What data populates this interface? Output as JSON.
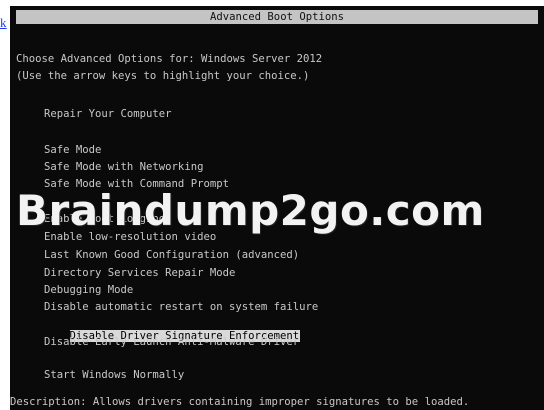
{
  "left_link": {
    "text": "k"
  },
  "console": {
    "title": "Advanced Boot Options",
    "intro_line1": "Choose Advanced Options for: Windows Server 2012",
    "intro_line2": "(Use the arrow keys to highlight your choice.)",
    "menu": {
      "repair": "Repair Your Computer",
      "safe_mode": "Safe Mode",
      "safe_mode_networking": "Safe Mode with Networking",
      "safe_mode_cmd": "Safe Mode with Command Prompt",
      "boot_logging": "Enable Boot Logging",
      "low_res_video": "Enable low-resolution video",
      "last_known_good": "Last Known Good Configuration (advanced)",
      "ds_repair": "Directory Services Repair Mode",
      "debugging": "Debugging Mode",
      "disable_auto_restart": "Disable automatic restart on system failure",
      "disable_driver_sig": "Disable Driver Signature Enforcement",
      "disable_elam": "Disable Early Launch Anti-Malware Driver",
      "start_normally": "Start Windows Normally"
    },
    "selected_item": "disable_driver_sig",
    "description_line": "Description: Allows drivers containing improper signatures to be loaded."
  },
  "watermark": {
    "text": "Braindump2go.com"
  },
  "colors": {
    "console_bg": "#0a0a0a",
    "console_text": "#c8c8c8",
    "title_bg": "#c4c4c4",
    "highlight_bg": "#d9d9d9",
    "link": "#1a3cff",
    "watermark": "#f2f2f2"
  }
}
